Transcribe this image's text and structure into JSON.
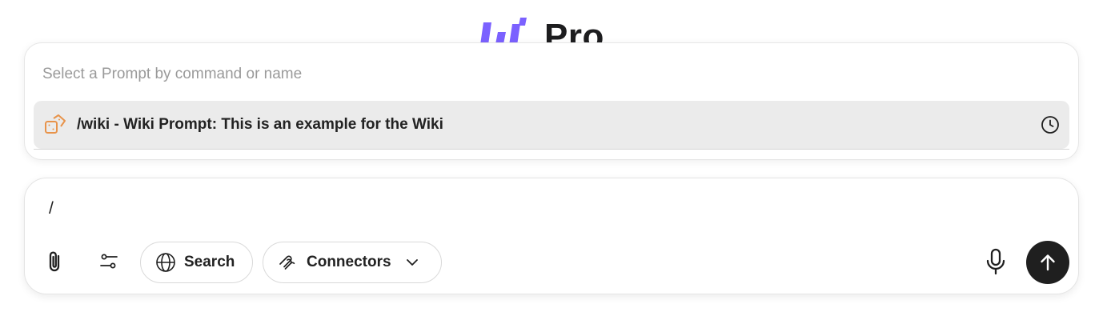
{
  "brand": {
    "logo_text": "Pro",
    "logo_color": "#7b61ff"
  },
  "prompt_picker": {
    "placeholder": "Select a Prompt by command or name",
    "items": [
      {
        "label": "/wiki - Wiki Prompt: This is an example for the Wiki",
        "icon": "dice-icon",
        "trailing_icon": "clock-icon",
        "icon_color": "#e8934a"
      }
    ]
  },
  "composer": {
    "text": "/",
    "attach_icon": "paperclip-icon",
    "settings_icon": "sliders-icon",
    "search_label": "Search",
    "search_icon": "globe-icon",
    "connectors_label": "Connectors",
    "connectors_icon": "connectors-icon",
    "mic_icon": "microphone-icon",
    "send_icon": "arrow-up-icon"
  }
}
